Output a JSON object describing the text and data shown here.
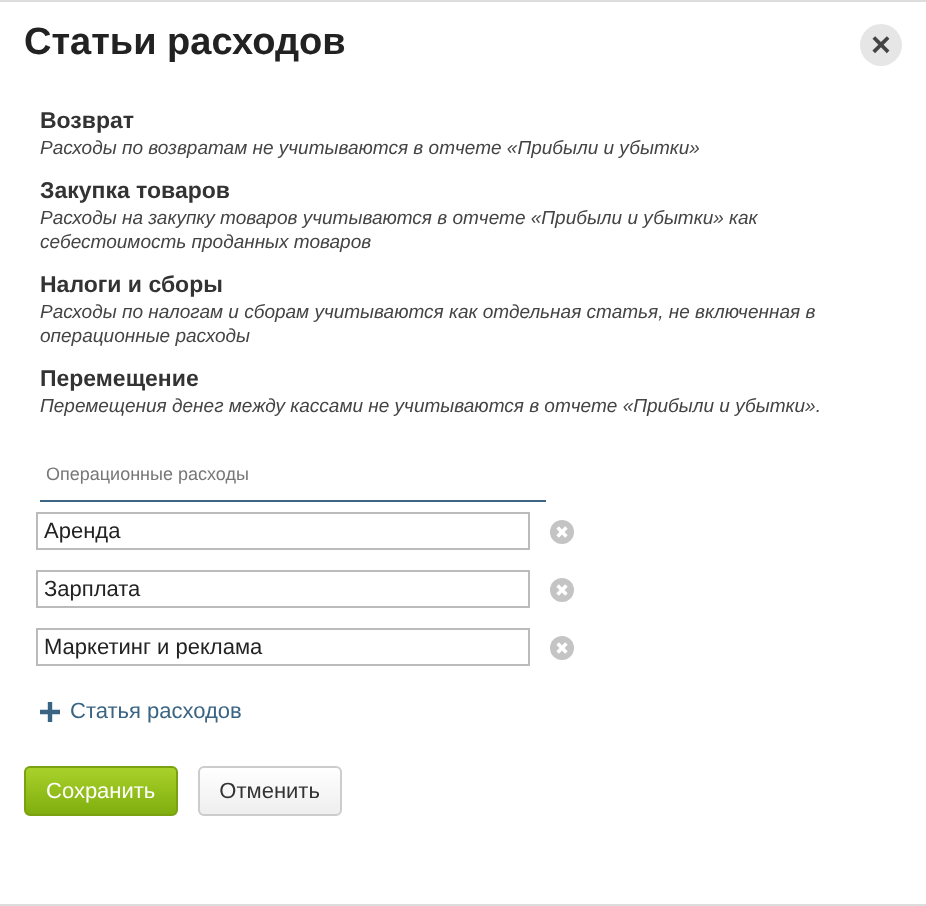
{
  "dialog": {
    "title": "Статьи расходов",
    "close": "×"
  },
  "sections": [
    {
      "heading": "Возврат",
      "description": "Расходы по возвратам не учитываются в отчете «Прибыли и убытки»"
    },
    {
      "heading": "Закупка товаров",
      "description": "Расходы на закупку товаров учитываются в отчете «Прибыли и убытки» как себестоимость проданных товаров"
    },
    {
      "heading": "Налоги и сборы",
      "description": "Расходы по налогам и сборам учитываются как отдельная статья, не включенная в операционные расходы"
    },
    {
      "heading": "Перемещение",
      "description": "Перемещения денег между кассами не учитываются в отчете «Прибыли и убытки»."
    }
  ],
  "group": {
    "label": "Операционные расходы",
    "items": [
      {
        "value": "Аренда"
      },
      {
        "value": "Зарплата"
      },
      {
        "value": "Маркетинг и реклама"
      }
    ],
    "add": "Статья расходов"
  },
  "buttons": [
    {
      "kind": "primary",
      "label": "Сохранить"
    },
    {
      "kind": "secondary",
      "label": "Отменить"
    }
  ]
}
